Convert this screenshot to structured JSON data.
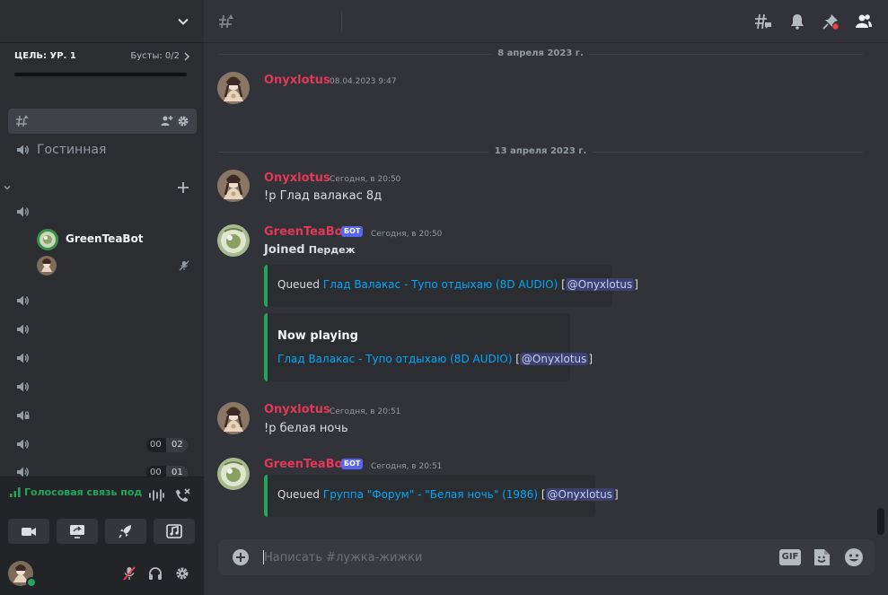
{
  "server": {
    "boost_goal": "ЦЕЛЬ: УР. 1",
    "boost_count": "Бусты: 0/2"
  },
  "channels": {
    "lounge": "Гостинная"
  },
  "voice_users": [
    {
      "name": "GreenTeaBot"
    },
    {
      "name": ""
    }
  ],
  "voice_counters": [
    {
      "a": "00",
      "b": "02"
    },
    {
      "a": "00",
      "b": "01"
    }
  ],
  "voice_panel": {
    "status": "Голосовая связь под"
  },
  "composer": {
    "placeholder": "Написать #лужка-жижки",
    "gif": "GIF"
  },
  "dividers": [
    "8 апреля 2023 г.",
    "13 апреля 2023 г."
  ],
  "messages": [
    {
      "author": "Onyxlotus",
      "time": "08.04.2023 9:47"
    },
    {
      "author": "Onyxlotus",
      "time": "Сегодня, в 20:50",
      "text": "!p Глад валакас 8д"
    },
    {
      "author": "GreenTeaBot",
      "bot": "БОТ",
      "time": "Сегодня, в 20:50",
      "joined": "Joined",
      "joined_channel": "Пердеж",
      "embed1": {
        "prefix": "Queued",
        "link": "Глад Валакас - Тупо отдыхаю (8D AUDIO)",
        "mention": "@Onyxlotus"
      },
      "embed2": {
        "title": "Now playing",
        "link": "Глад Валакас - Тупо отдыхаю (8D AUDIO)",
        "mention": "@Onyxlotus"
      }
    },
    {
      "author": "Onyxlotus",
      "time": "Сегодня, в 20:51",
      "text": "!p белая ночь"
    },
    {
      "author": "GreenTeaBot",
      "bot": "БОТ",
      "time": "Сегодня, в 20:51",
      "embed1": {
        "prefix": "Queued",
        "link": "Группа \"Форум\" - \"Белая ночь\" (1986)",
        "mention": "@Onyxlotus"
      }
    }
  ],
  "colors": {
    "accent": "#5865f2",
    "online": "#23a55a",
    "author": "#e2385a",
    "link": "#00a8fc"
  }
}
